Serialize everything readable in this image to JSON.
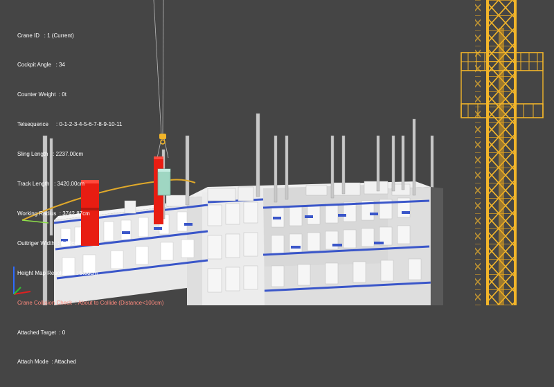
{
  "window": {
    "title": ""
  },
  "hud": {
    "lines": [
      {
        "id": "crane-id",
        "text": "Crane ID   : 1 (Current)",
        "alert": false
      },
      {
        "id": "cockpit-angle",
        "text": "Cockpit Angle   : 34",
        "alert": false
      },
      {
        "id": "counter-weight",
        "text": "Counter Weight  : 0t",
        "alert": false
      },
      {
        "id": "telsequence",
        "text": "Telsequence     : 0-1-2-3-4-5-6-7-8-9-10-11",
        "alert": false
      },
      {
        "id": "sling-length",
        "text": "Sling Length   : 2237.00cm",
        "alert": false
      },
      {
        "id": "track-length",
        "text": "Track Length   : 3420.00cm",
        "alert": false
      },
      {
        "id": "working-radius",
        "text": "Working Radius  : 3742.87cm",
        "alert": false
      },
      {
        "id": "outtriger-width",
        "text": "Outtriger Width  : 0.00cm",
        "alert": false
      },
      {
        "id": "height-map-resolution",
        "text": "Height Map Resolution  : 5.00cm",
        "alert": false
      },
      {
        "id": "crane-collision-check",
        "text": "Crane Collision Check  : About to Collide (Distance<100cm)",
        "alert": true
      },
      {
        "id": "attached-target",
        "text": "Attached Target  : 0",
        "alert": false
      },
      {
        "id": "attach-mode",
        "text": "Attach Mode  : Attached",
        "alert": false
      }
    ]
  },
  "scene": {
    "background_color": "#454545",
    "building_color": "#e6e6e6",
    "floor_accent_color": "#3a56c9",
    "crane_color": "#f2b52a",
    "collision_box_color": "#e81d12",
    "radius_arc_color": "#e0a92a",
    "load_color": "#9fd6c2",
    "alert_text_color": "#ff8a7e"
  }
}
